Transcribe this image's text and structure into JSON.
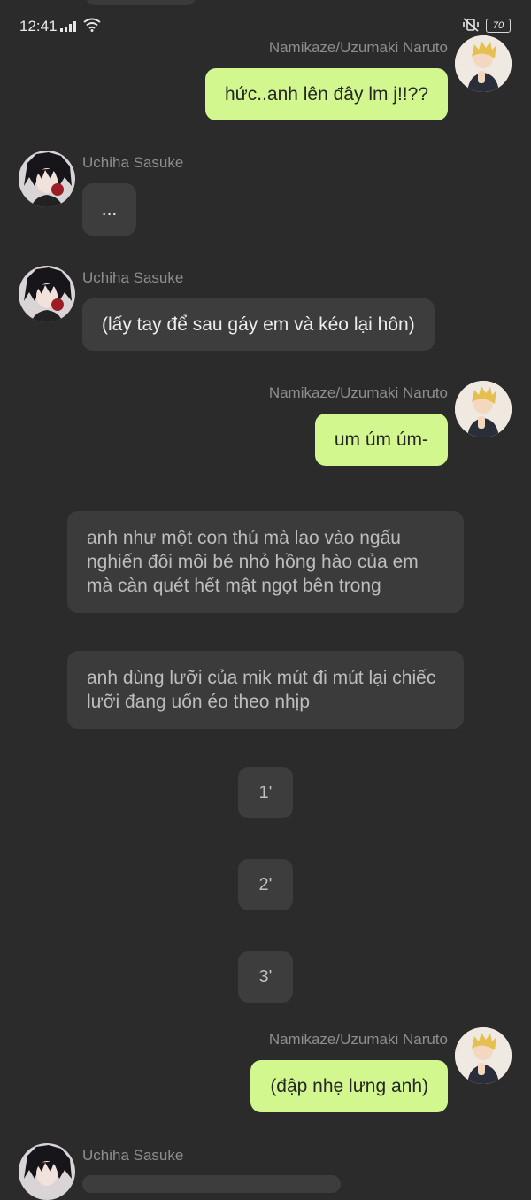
{
  "status_bar": {
    "time": "12:41",
    "battery": "70"
  },
  "messages": [
    {
      "sender": "Namikaze/Uzumaki Naruto",
      "text": "hức..anh lên đây lm j!!??"
    },
    {
      "sender": "Uchiha Sasuke",
      "text": "..."
    },
    {
      "sender": "Uchiha Sasuke",
      "text": "(lấy tay để sau gáy em và kéo lại hôn)"
    },
    {
      "sender": "Namikaze/Uzumaki Naruto",
      "text": "um úm úm-"
    },
    {
      "narration": "anh như một con thú mà lao vào ngấu nghiến đôi môi bé nhỏ hồng hào của em mà càn quét hết mật ngọt bên trong"
    },
    {
      "narration": "anh dùng lưỡi của mik mút đi mút lại chiếc lưỡi đang uốn éo theo nhịp"
    },
    {
      "narration": "1'"
    },
    {
      "narration": "2'"
    },
    {
      "narration": "3'"
    },
    {
      "sender": "Namikaze/Uzumaki Naruto",
      "text": "(đập nhẹ lưng anh)"
    },
    {
      "sender": "Uchiha Sasuke",
      "text": ""
    }
  ],
  "colors": {
    "background": "#2b2b2b",
    "my_bubble": "#d3f78f",
    "other_bubble": "#3d3d3d",
    "name": "#8e8e8e"
  }
}
